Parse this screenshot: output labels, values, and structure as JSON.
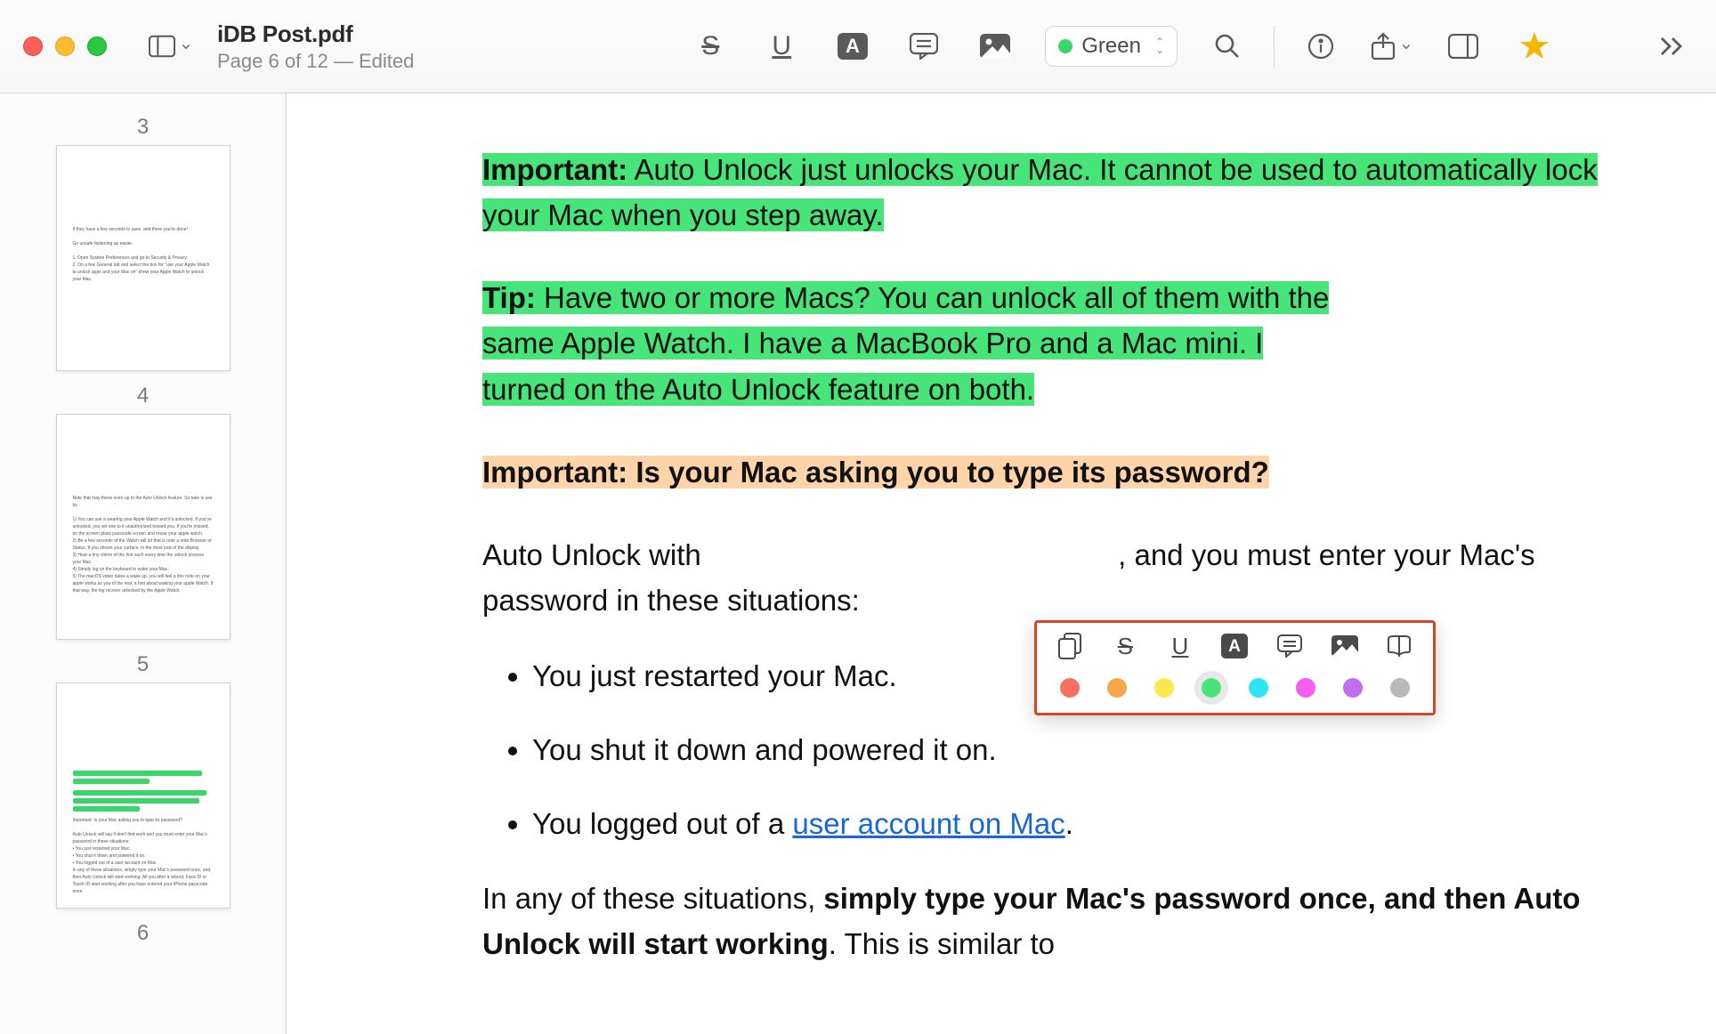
{
  "window": {
    "title": "iDB Post.pdf",
    "subtitle": "Page 6 of 12 — Edited"
  },
  "toolbar": {
    "sidebar_toggle": "sidebar-toggle-icon",
    "strikethrough": "S",
    "underline": "U",
    "color_dropdown": {
      "label": "Green",
      "swatch": "#3bd66a"
    }
  },
  "sidebar": {
    "top_page_num": "3",
    "thumbs": [
      {
        "num": "4"
      },
      {
        "num": "5"
      },
      {
        "num": "6"
      }
    ]
  },
  "content": {
    "important_label": "Important:",
    "important_text": " Auto Unlock just unlocks your Mac. It cannot be used to automatically lock your Mac when you step away.",
    "tip_label": "Tip:",
    "tip_text_1": " Have two or more Macs? You can unlock all of them with the ",
    "tip_text_2": "same Apple Watch. I have a MacBook Pro and a Mac mini. I ",
    "tip_text_3": "turned on the Auto Unlock feature on both.",
    "heading_orange": "Important: Is your Mac asking you to type its password?",
    "body_1a": "Auto Unlock with",
    "body_1b": ", and you must enter your Mac's password in these situations:",
    "bullet_1": "You just restarted your Mac.",
    "bullet_2": "You shut it down and powered it on.",
    "bullet_3_a": "You logged out of a ",
    "bullet_3_link": "user account on Mac",
    "bullet_3_b": ".",
    "body_2_a": "In any of these situations, ",
    "body_2_bold": "simply type your Mac's password once, and then Auto Unlock will start working",
    "body_2_b": ". This is similar to"
  },
  "popup": {
    "colors": [
      "#f87062",
      "#f5a749",
      "#f7e94e",
      "#47e47a",
      "#2ee5f7",
      "#f55ff0",
      "#c46df0",
      "#b8b8b8"
    ]
  }
}
